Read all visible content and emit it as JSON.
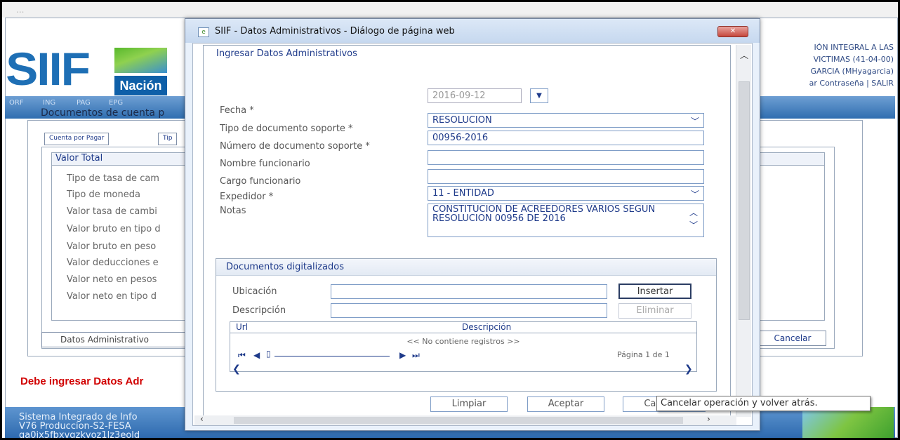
{
  "background": {
    "top_strip_text": "...",
    "logo": {
      "brand": "SIIF",
      "sub": "Nación"
    },
    "right_info": {
      "line1": "IÓN INTEGRAL A LAS",
      "line2": "VICTIMAS (41-04-00)",
      "line3": "GARCIA (MHyagarcia)",
      "line4": "ar Contraseña | SALIR"
    },
    "menu": [
      "ORF",
      "ING",
      "PAG",
      "EPG"
    ],
    "breadcrumb": "Documentos de cuenta p",
    "tabs": [
      "Cuenta por Pagar",
      "Tip"
    ],
    "valor_total_header": "Valor Total",
    "rows": [
      "Tipo de tasa de cam",
      "Tipo de moneda",
      "Valor tasa de cambi",
      "Valor bruto en tipo d",
      "Valor bruto en peso",
      "Valor deducciones e",
      "Valor neto en pesos",
      "Valor neto en tipo d"
    ],
    "datos_admin_button": "Datos Administrativo",
    "cancel_button": "Cancelar",
    "error_message": "Debe ingresar Datos Adr",
    "footer": {
      "line1": "Sistema Integrado de Info",
      "line2": "V76 Produccion-S2-FESA",
      "line3": "ga0ix5fbxvgzkvoz1lz3eold"
    }
  },
  "dialog": {
    "title": "SIIF - Datos Administrativos - Diálogo de página web",
    "close_label": "✕",
    "section_title": "Ingresar Datos Administrativos",
    "fields": {
      "fecha_label": "Fecha *",
      "fecha_value": "2016-09-12",
      "tipo_doc_label": "Tipo de documento soporte *",
      "tipo_doc_value": "RESOLUCION",
      "num_doc_label": "Número de documento soporte *",
      "num_doc_value": "00956-2016",
      "nombre_label": "Nombre funcionario",
      "nombre_value": "",
      "cargo_label": "Cargo funcionario",
      "cargo_value": "",
      "expedidor_label": "Expedidor *",
      "expedidor_value": "11 - ENTIDAD",
      "notas_label": "Notas",
      "notas_value": "CONSTITUCION DE ACREEDORES VARIOS SEGUN RESOLUCION 00956 DE 2016"
    },
    "digital": {
      "title": "Documentos digitalizados",
      "ubicacion_label": "Ubicación",
      "ubicacion_value": "",
      "descripcion_label": "Descripción",
      "descripcion_value": "",
      "insert_button": "Insertar",
      "delete_button": "Eliminar",
      "grid_headers": [
        "Url",
        "Descripción"
      ],
      "empty_message": "<< No contiene registros >>",
      "page_info": "Página 1 de 1"
    },
    "buttons": {
      "clear": "Limpiar",
      "accept": "Aceptar",
      "cancel": "Cancelar"
    },
    "tooltip": "Cancelar operación y volver atrás."
  }
}
